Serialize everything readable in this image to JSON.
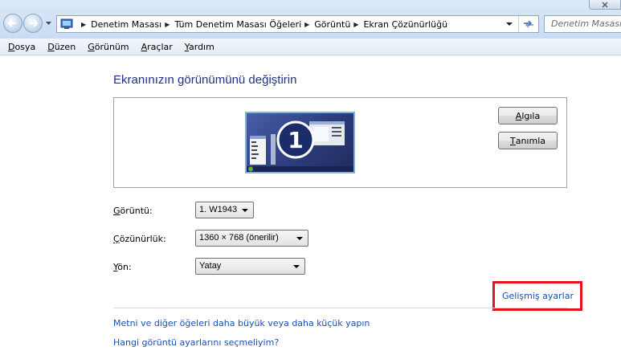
{
  "address_bar": {
    "breadcrumbs": [
      "Denetim Masası",
      "Tüm Denetim Masası Öğeleri",
      "Görüntü",
      "Ekran Çözünürlüğü"
    ],
    "search_placeholder": "Denetim Masası"
  },
  "menu": [
    {
      "label": "Dosya",
      "underline": "D",
      "rest": "osya"
    },
    {
      "label": "Düzen",
      "underline": "D",
      "rest": "üzen"
    },
    {
      "label": "Görünüm",
      "underline": "G",
      "rest": "örünüm"
    },
    {
      "label": "Araçlar",
      "underline": "A",
      "rest": "raçlar"
    },
    {
      "label": "Yardım",
      "underline": "Y",
      "rest": "ardım"
    }
  ],
  "page": {
    "title": "Ekranınızın görünümünü değiştirin",
    "monitor_number": "1",
    "detect_button": {
      "first": "A",
      "rest": "lgıla"
    },
    "identify_button": {
      "first": "T",
      "rest": "anımla"
    },
    "display_label": {
      "first": "G",
      "rest": "örüntü:"
    },
    "display_value": "1. W1943",
    "resolution_label": {
      "first": "Ç",
      "rest": "özünürlük:"
    },
    "resolution_value": "1360 × 768 (önerilir)",
    "orientation_label": {
      "first": "Y",
      "rest": "ön:"
    },
    "orientation_value": "Yatay",
    "advanced_settings_link": "Gelişmiş ayarlar",
    "text_size_link": "Metni ve diğer öğeleri daha büyük veya daha küçük yapın",
    "help_link": "Hangi görüntü ayarlarını seçmeliyim?"
  },
  "colors": {
    "title": "#1e3287",
    "link": "#1b4fb3",
    "highlight": "#e2161c"
  }
}
